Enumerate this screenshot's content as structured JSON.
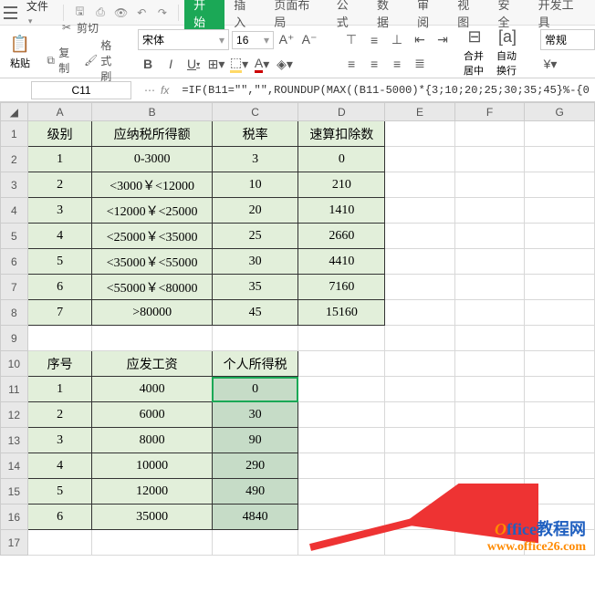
{
  "menubar": {
    "file": "文件"
  },
  "tabs": {
    "start": "开始",
    "insert": "插入",
    "layout": "页面布局",
    "formula": "公式",
    "data": "数据",
    "review": "审阅",
    "view": "视图",
    "security": "安全",
    "devtools": "开发工具"
  },
  "ribbon": {
    "paste": "粘贴",
    "cut": "剪切",
    "copy": "复制",
    "format_painter": "格式刷",
    "font_name": "宋体",
    "font_size": "16",
    "merge_center": "合并居中",
    "wrap_text": "自动换行",
    "general": "常规"
  },
  "namebox": "C11",
  "formula": "=IF(B11=\"\",\"\",ROUNDUP(MAX((B11-5000)*{3;10;20;25;30;35;45}%-{0",
  "columns": [
    "A",
    "B",
    "C",
    "D",
    "E",
    "F",
    "G"
  ],
  "t1": {
    "h": [
      "级别",
      "应纳税所得额",
      "税率",
      "速算扣除数"
    ],
    "r": [
      [
        "1",
        "0-3000",
        "3",
        "0"
      ],
      [
        "2",
        "<3000￥<12000",
        "10",
        "210"
      ],
      [
        "3",
        "<12000￥<25000",
        "20",
        "1410"
      ],
      [
        "4",
        "<25000￥<35000",
        "25",
        "2660"
      ],
      [
        "5",
        "<35000￥<55000",
        "30",
        "4410"
      ],
      [
        "6",
        "<55000￥<80000",
        "35",
        "7160"
      ],
      [
        "7",
        ">80000",
        "45",
        "15160"
      ]
    ]
  },
  "t2": {
    "h": [
      "序号",
      "应发工资",
      "个人所得税"
    ],
    "r": [
      [
        "1",
        "4000",
        "0"
      ],
      [
        "2",
        "6000",
        "30"
      ],
      [
        "3",
        "8000",
        "90"
      ],
      [
        "4",
        "10000",
        "290"
      ],
      [
        "5",
        "12000",
        "490"
      ],
      [
        "6",
        "35000",
        "4840"
      ]
    ]
  },
  "watermark": {
    "line1a": "O",
    "line1b": "ffice教程网",
    "line2": "www.office26.com"
  }
}
